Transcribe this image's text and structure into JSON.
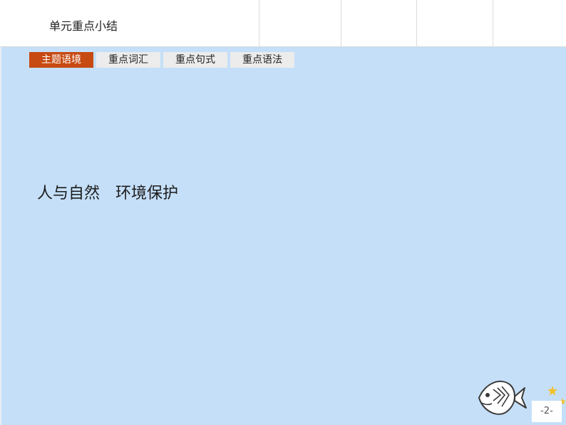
{
  "header": {
    "title": "单元重点小结"
  },
  "tabs": [
    {
      "label": "主题语境",
      "active": true
    },
    {
      "label": "重点词汇",
      "active": false
    },
    {
      "label": "重点句式",
      "active": false
    },
    {
      "label": "重点语法",
      "active": false
    }
  ],
  "content": {
    "topic": "人与自然　环境保护"
  },
  "footer": {
    "page_number": "-2-",
    "decoration_icon": "fish-icon"
  },
  "colors": {
    "background": "#c5dff8",
    "active_tab": "#c74a12",
    "inactive_tab": "#ececec"
  }
}
